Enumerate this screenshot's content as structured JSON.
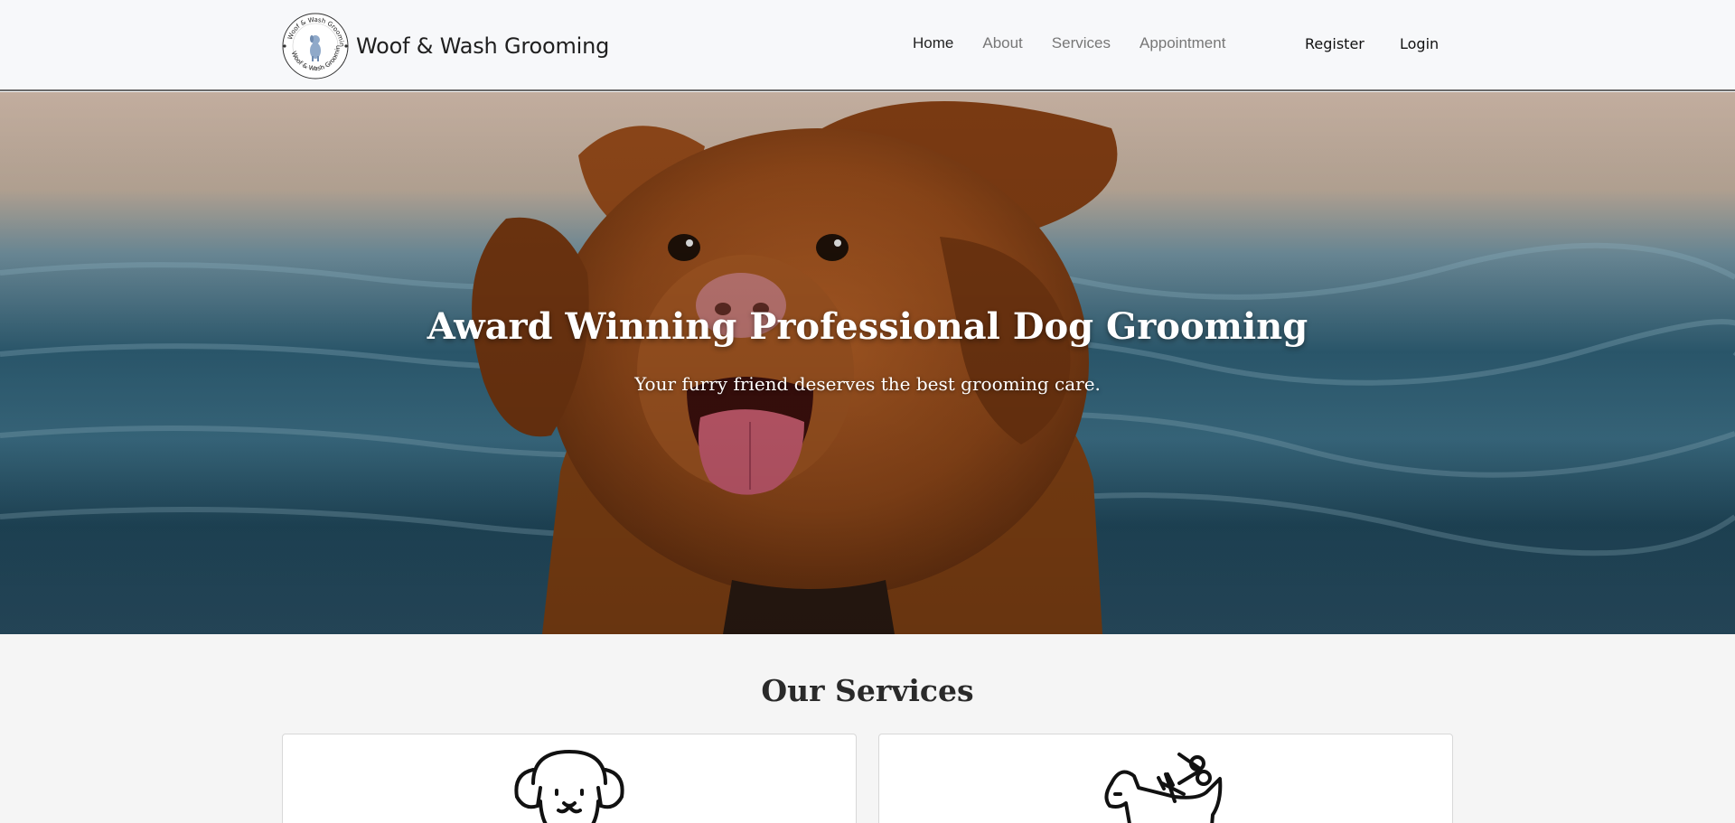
{
  "brand": {
    "name": "Woof & Wash Grooming",
    "logo_text": "Woof & Wash Grooming",
    "logo_icon": "dog-logo-icon"
  },
  "nav": {
    "links": [
      {
        "label": "Home",
        "active": true
      },
      {
        "label": "About",
        "active": false
      },
      {
        "label": "Services",
        "active": false
      },
      {
        "label": "Appointment",
        "active": false
      }
    ],
    "register": "Register",
    "login": "Login"
  },
  "hero": {
    "title": "Award Winning Professional Dog Grooming",
    "subtitle": "Your furry friend deserves the best grooming care.",
    "image": "dog-at-sea-photo"
  },
  "services": {
    "title": "Our Services",
    "cards": [
      {
        "icon": "puppy-face-icon"
      },
      {
        "icon": "dog-grooming-scissors-icon"
      }
    ]
  },
  "colors": {
    "nav_bg": "#f7f8fa",
    "page_bg": "#f5f5f5",
    "text_dark": "#222222",
    "text_muted": "#777777"
  }
}
